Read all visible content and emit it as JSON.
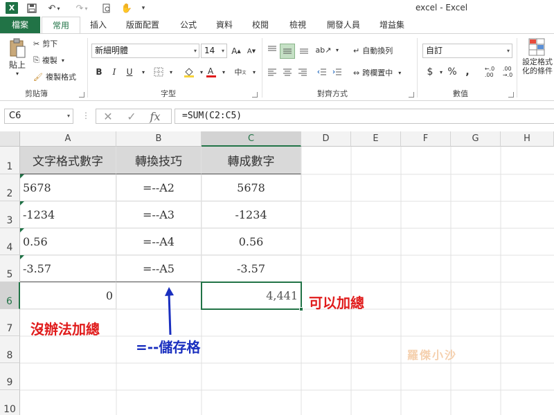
{
  "window": {
    "title": "excel - Excel"
  },
  "tabs": [
    "檔案",
    "常用",
    "插入",
    "版面配置",
    "公式",
    "資料",
    "校閱",
    "檢視",
    "開發人員",
    "增益集"
  ],
  "ribbon": {
    "clipboard": {
      "paste": "貼上",
      "cut": "剪下",
      "copy": "複製",
      "format_painter": "複製格式",
      "label": "剪貼簿"
    },
    "font": {
      "name": "新細明體",
      "size": "14",
      "bold": "B",
      "italic": "I",
      "underline": "U",
      "label": "字型"
    },
    "alignment": {
      "wrap": "自動換列",
      "merge": "跨欄置中",
      "label": "對齊方式"
    },
    "number": {
      "format": "自訂",
      "currency": "$",
      "percent": "%",
      "comma": ",",
      "label": "數值"
    },
    "styles": {
      "conditional": "設定格式化的條件"
    }
  },
  "formula_bar": {
    "name_box": "C6",
    "formula": "=SUM(C2:C5)",
    "fx": "fx"
  },
  "columns": [
    "A",
    "B",
    "C",
    "D",
    "E",
    "F",
    "G",
    "H"
  ],
  "rows": [
    "1",
    "2",
    "3",
    "4",
    "5",
    "6",
    "7",
    "8",
    "9",
    "10"
  ],
  "cells": {
    "A1": "文字格式數字",
    "B1": "轉換技巧",
    "C1": "轉成數字",
    "A2": "5678",
    "B2": "=--A2",
    "C2": "5678",
    "A3": "-1234",
    "B3": "=--A3",
    "C3": "-1234",
    "A4": "0.56",
    "B4": "=--A4",
    "C4": "0.56",
    "A5": "-3.57",
    "B5": "=--A5",
    "C5": "-3.57",
    "A6": "0",
    "C6": "4,441"
  },
  "annotations": {
    "can_sum": "可以加總",
    "cannot_sum": "沒辦法加總",
    "cell_note": "=--儲存格",
    "watermark": "羅傑小沙"
  },
  "colors": {
    "excel_green": "#217346",
    "annot_red": "#e01b1b",
    "annot_blue": "#1a2fbf"
  }
}
